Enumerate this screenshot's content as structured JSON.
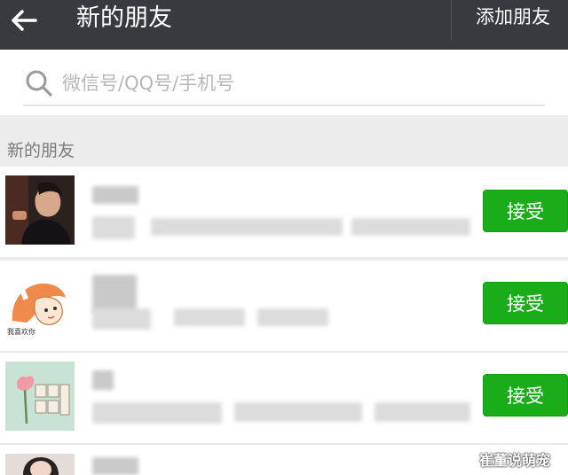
{
  "header": {
    "title": "新的朋友",
    "add_friend_label": "添加朋友"
  },
  "search": {
    "placeholder": "微信号/QQ号/手机号"
  },
  "section": {
    "title": "新的朋友"
  },
  "requests": [
    {
      "action_label": "接受",
      "avatar_caption": ""
    },
    {
      "action_label": "接受",
      "avatar_caption": "我喜欢你"
    },
    {
      "action_label": "接受",
      "avatar_caption": ""
    }
  ],
  "watermark": "崔董说萌宠",
  "colors": {
    "topbar": "#393a3f",
    "accept": "#1aad19",
    "background": "#ececec"
  },
  "icons": {
    "back": "arrow-left-icon",
    "search": "search-icon"
  }
}
